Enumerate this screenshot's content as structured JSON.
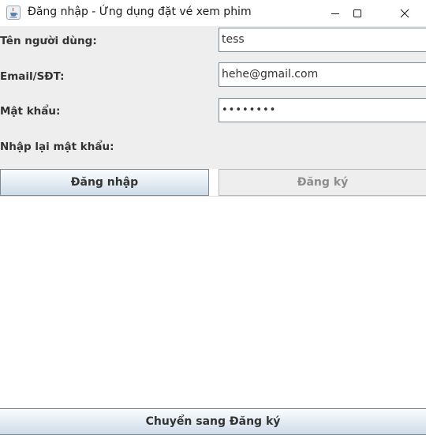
{
  "window": {
    "title": "Đăng nhập - Ứng dụng đặt vé xem phim",
    "icon": "java-cup-icon",
    "controls": [
      "minimize-icon",
      "maximize-icon",
      "close-icon"
    ]
  },
  "form": {
    "username_label": "Tên người dùng:",
    "username_value": "tess",
    "email_label": "Email/SĐT:",
    "email_value": "hehe@gmail.com",
    "password_label": "Mật khẩu:",
    "password_value": "••••••••",
    "confirm_password_label": "Nhập lại mật khẩu:"
  },
  "buttons": {
    "login": "Đăng nhập",
    "register": "Đăng ký",
    "switch_to_register": "Chuyển sang Đăng ký"
  },
  "colors": {
    "panel_background": "#eeeeee",
    "button_gradient_top": "#fbfcfd",
    "button_gradient_bottom": "#cfdbe8",
    "disabled_text": "#8d8d8d",
    "field_border": "#7a8a99"
  },
  "state": {
    "register_button_enabled": false
  }
}
